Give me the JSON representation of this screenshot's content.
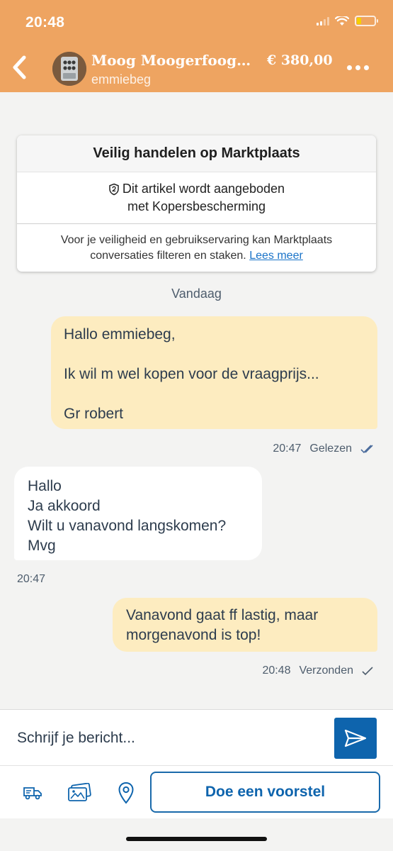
{
  "status_bar": {
    "time": "20:48"
  },
  "header": {
    "title": "Moog Moogerfooger...",
    "price": "€ 380,00",
    "seller": "emmiebeg"
  },
  "safety": {
    "title": "Veilig handelen op Marktplaats",
    "protect_line1": "Dit artikel wordt aangeboden",
    "protect_line2": "met Kopersbescherming",
    "info_line1": "Voor je veiligheid en gebruikservaring kan Marktplaats",
    "info_line2": "conversaties filteren en staken.",
    "info_link": "Lees meer"
  },
  "day_label": "Vandaag",
  "messages": [
    {
      "direction": "out",
      "text": "Hallo emmiebeg,\n\nIk wil m wel kopen voor de vraagprijs...\n\nGr robert",
      "time": "20:47",
      "status": "Gelezen"
    },
    {
      "direction": "in",
      "text": "Hallo\nJa akkoord\nWilt u vanavond langskomen?\nMvg",
      "time": "20:47"
    },
    {
      "direction": "out",
      "text": "Vanavond gaat ff lastig, maar\nmorgenavond is top!",
      "time": "20:48",
      "status": "Verzonden"
    }
  ],
  "composer": {
    "placeholder": "Schrijf je bericht..."
  },
  "toolbar": {
    "propose_label": "Doe een voorstel"
  },
  "colors": {
    "header": "#eea461",
    "accent": "#0e64ad",
    "bubble_out": "#fdecc0",
    "bubble_in": "#ffffff"
  }
}
